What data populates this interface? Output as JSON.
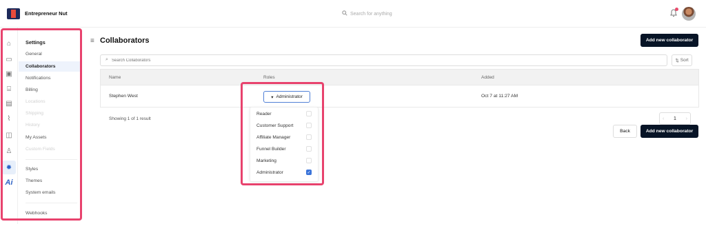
{
  "app": {
    "title": "Entrepreneur Nut",
    "search_placeholder": "Search for anything"
  },
  "header": {
    "notification_icon": "bell-icon",
    "avatar_icon": "user-avatar"
  },
  "rail": {
    "icons": [
      "home-icon",
      "window-icon",
      "calendar-icon",
      "cart-icon",
      "card-icon",
      "chart-icon",
      "user-card-icon",
      "people-icon",
      "settings-gear-icon",
      "ai-icon"
    ],
    "ai_label": "Ai"
  },
  "sidebar": {
    "title": "Settings",
    "items": [
      {
        "label": "General",
        "state": "normal"
      },
      {
        "label": "Collaborators",
        "state": "active"
      },
      {
        "label": "Notifications",
        "state": "normal"
      },
      {
        "label": "Billing",
        "state": "normal"
      },
      {
        "label": "Locations",
        "state": "disabled"
      },
      {
        "label": "Shipping",
        "state": "disabled"
      },
      {
        "label": "History",
        "state": "disabled"
      },
      {
        "label": "My Assets",
        "state": "normal"
      },
      {
        "label": "Custom Fields",
        "state": "disabled"
      },
      {
        "label": "Styles",
        "state": "normal"
      },
      {
        "label": "Themes",
        "state": "normal"
      },
      {
        "label": "System emails",
        "state": "normal"
      },
      {
        "label": "Webhooks",
        "state": "normal"
      }
    ]
  },
  "main": {
    "title": "Collaborators",
    "top_button": "Add new collaborator",
    "search_placeholder": "Search Collaborators",
    "sort_label": "Sort",
    "table": {
      "columns": [
        "Name",
        "Roles",
        "Added"
      ],
      "rows": [
        {
          "name": "Stephen West",
          "role": "Administrator",
          "added": "Oct 7 at 11:27 AM"
        }
      ]
    },
    "showing": "Showing 1 of 1 result",
    "pagination": {
      "previous": "‹",
      "current": "1",
      "next": "›"
    },
    "back_button": "Back",
    "bottom_button": "Add new collaborator"
  },
  "roles_dropdown": {
    "options": [
      {
        "label": "Reader",
        "checked": false
      },
      {
        "label": "Customer Support",
        "checked": false
      },
      {
        "label": "Affiliate Manager",
        "checked": false
      },
      {
        "label": "Funnel Builder",
        "checked": false
      },
      {
        "label": "Marketing",
        "checked": false
      },
      {
        "label": "Administrator",
        "checked": true
      }
    ]
  },
  "colors": {
    "accent": "#2a63c7",
    "highlight": "#e8426d",
    "primary_button": "#071426"
  }
}
